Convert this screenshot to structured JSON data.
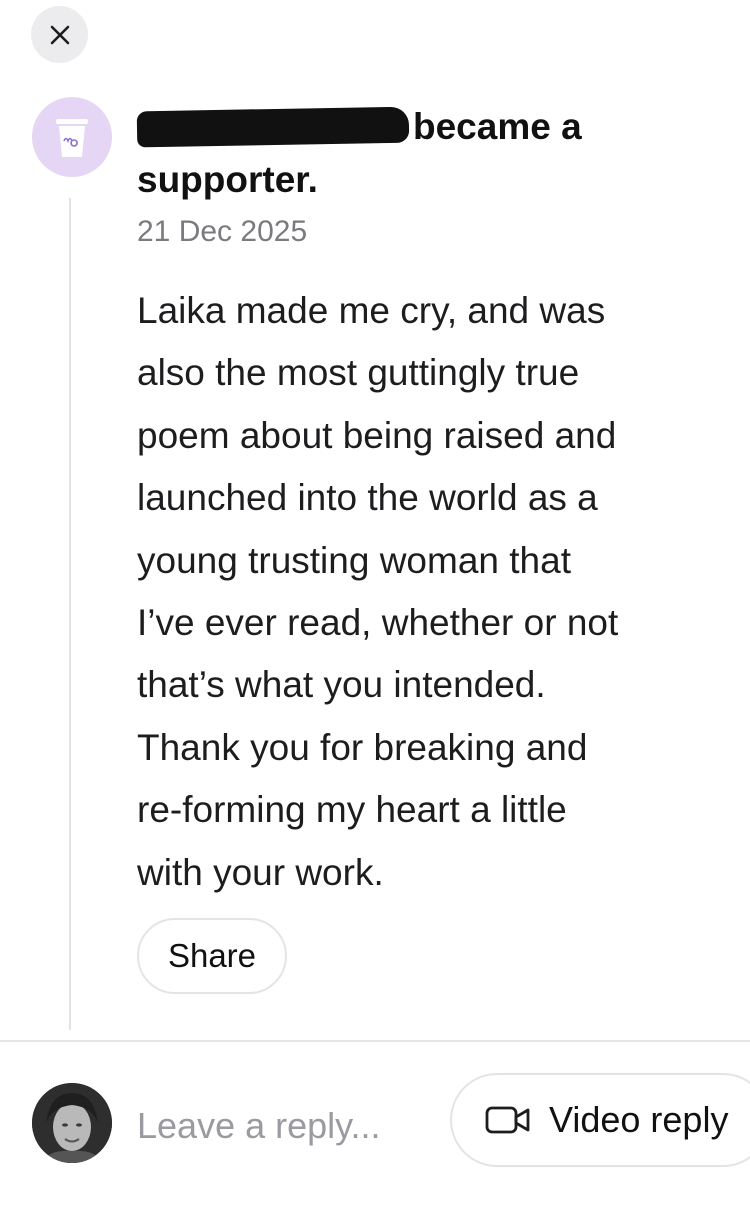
{
  "header": {
    "close_icon": "close-icon"
  },
  "supporter": {
    "avatar_icon": "coffee-cup-icon",
    "avatar_bg": "#e4d6f4",
    "headline_suffix": "became a supporter.",
    "date": "21 Dec 2025",
    "message_lines": [
      "Laika made me cry, and was",
      "also the most guttingly true",
      "poem about being raised and",
      "launched into the world as a",
      "young trusting woman that",
      "I’ve ever read, whether or not",
      "that’s what you intended.",
      "Thank you for breaking and",
      "re-forming my heart a little",
      "with your work."
    ],
    "share_label": "Share"
  },
  "reply": {
    "placeholder": "Leave a reply...",
    "video_reply_label": "Video reply",
    "video_icon": "video-camera-icon"
  }
}
